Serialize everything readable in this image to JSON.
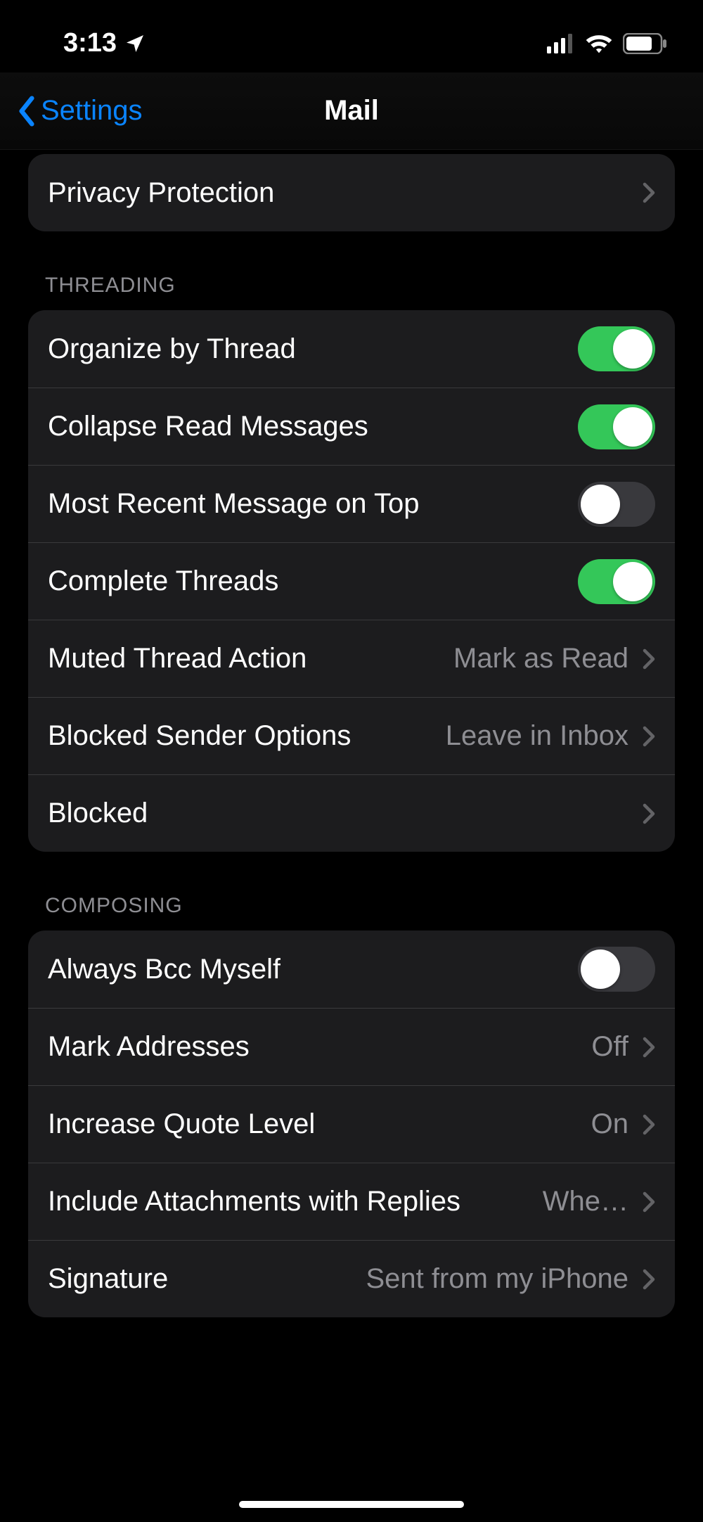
{
  "status": {
    "time": "3:13",
    "location_icon": "location-arrow",
    "signal_bars": 3,
    "wifi": true,
    "battery_pct": 75
  },
  "nav": {
    "back_label": "Settings",
    "title": "Mail"
  },
  "groups": [
    {
      "header": null,
      "rows": [
        {
          "id": "privacy-protection",
          "label": "Privacy Protection",
          "type": "disclosure"
        }
      ]
    },
    {
      "header": "THREADING",
      "rows": [
        {
          "id": "organize-by-thread",
          "label": "Organize by Thread",
          "type": "toggle",
          "on": true
        },
        {
          "id": "collapse-read-messages",
          "label": "Collapse Read Messages",
          "type": "toggle",
          "on": true
        },
        {
          "id": "most-recent-on-top",
          "label": "Most Recent Message on Top",
          "type": "toggle",
          "on": false
        },
        {
          "id": "complete-threads",
          "label": "Complete Threads",
          "type": "toggle",
          "on": true
        },
        {
          "id": "muted-thread-action",
          "label": "Muted Thread Action",
          "type": "disclosure",
          "value": "Mark as Read"
        },
        {
          "id": "blocked-sender-options",
          "label": "Blocked Sender Options",
          "type": "disclosure",
          "value": "Leave in Inbox"
        },
        {
          "id": "blocked",
          "label": "Blocked",
          "type": "disclosure"
        }
      ]
    },
    {
      "header": "COMPOSING",
      "rows": [
        {
          "id": "always-bcc-myself",
          "label": "Always Bcc Myself",
          "type": "toggle",
          "on": false
        },
        {
          "id": "mark-addresses",
          "label": "Mark Addresses",
          "type": "disclosure",
          "value": "Off"
        },
        {
          "id": "increase-quote-level",
          "label": "Increase Quote Level",
          "type": "disclosure",
          "value": "On"
        },
        {
          "id": "include-attachments",
          "label": "Include Attachments with Replies",
          "type": "disclosure",
          "value": "Whe…"
        },
        {
          "id": "signature",
          "label": "Signature",
          "type": "disclosure",
          "value": "Sent from my iPhone"
        }
      ]
    }
  ]
}
